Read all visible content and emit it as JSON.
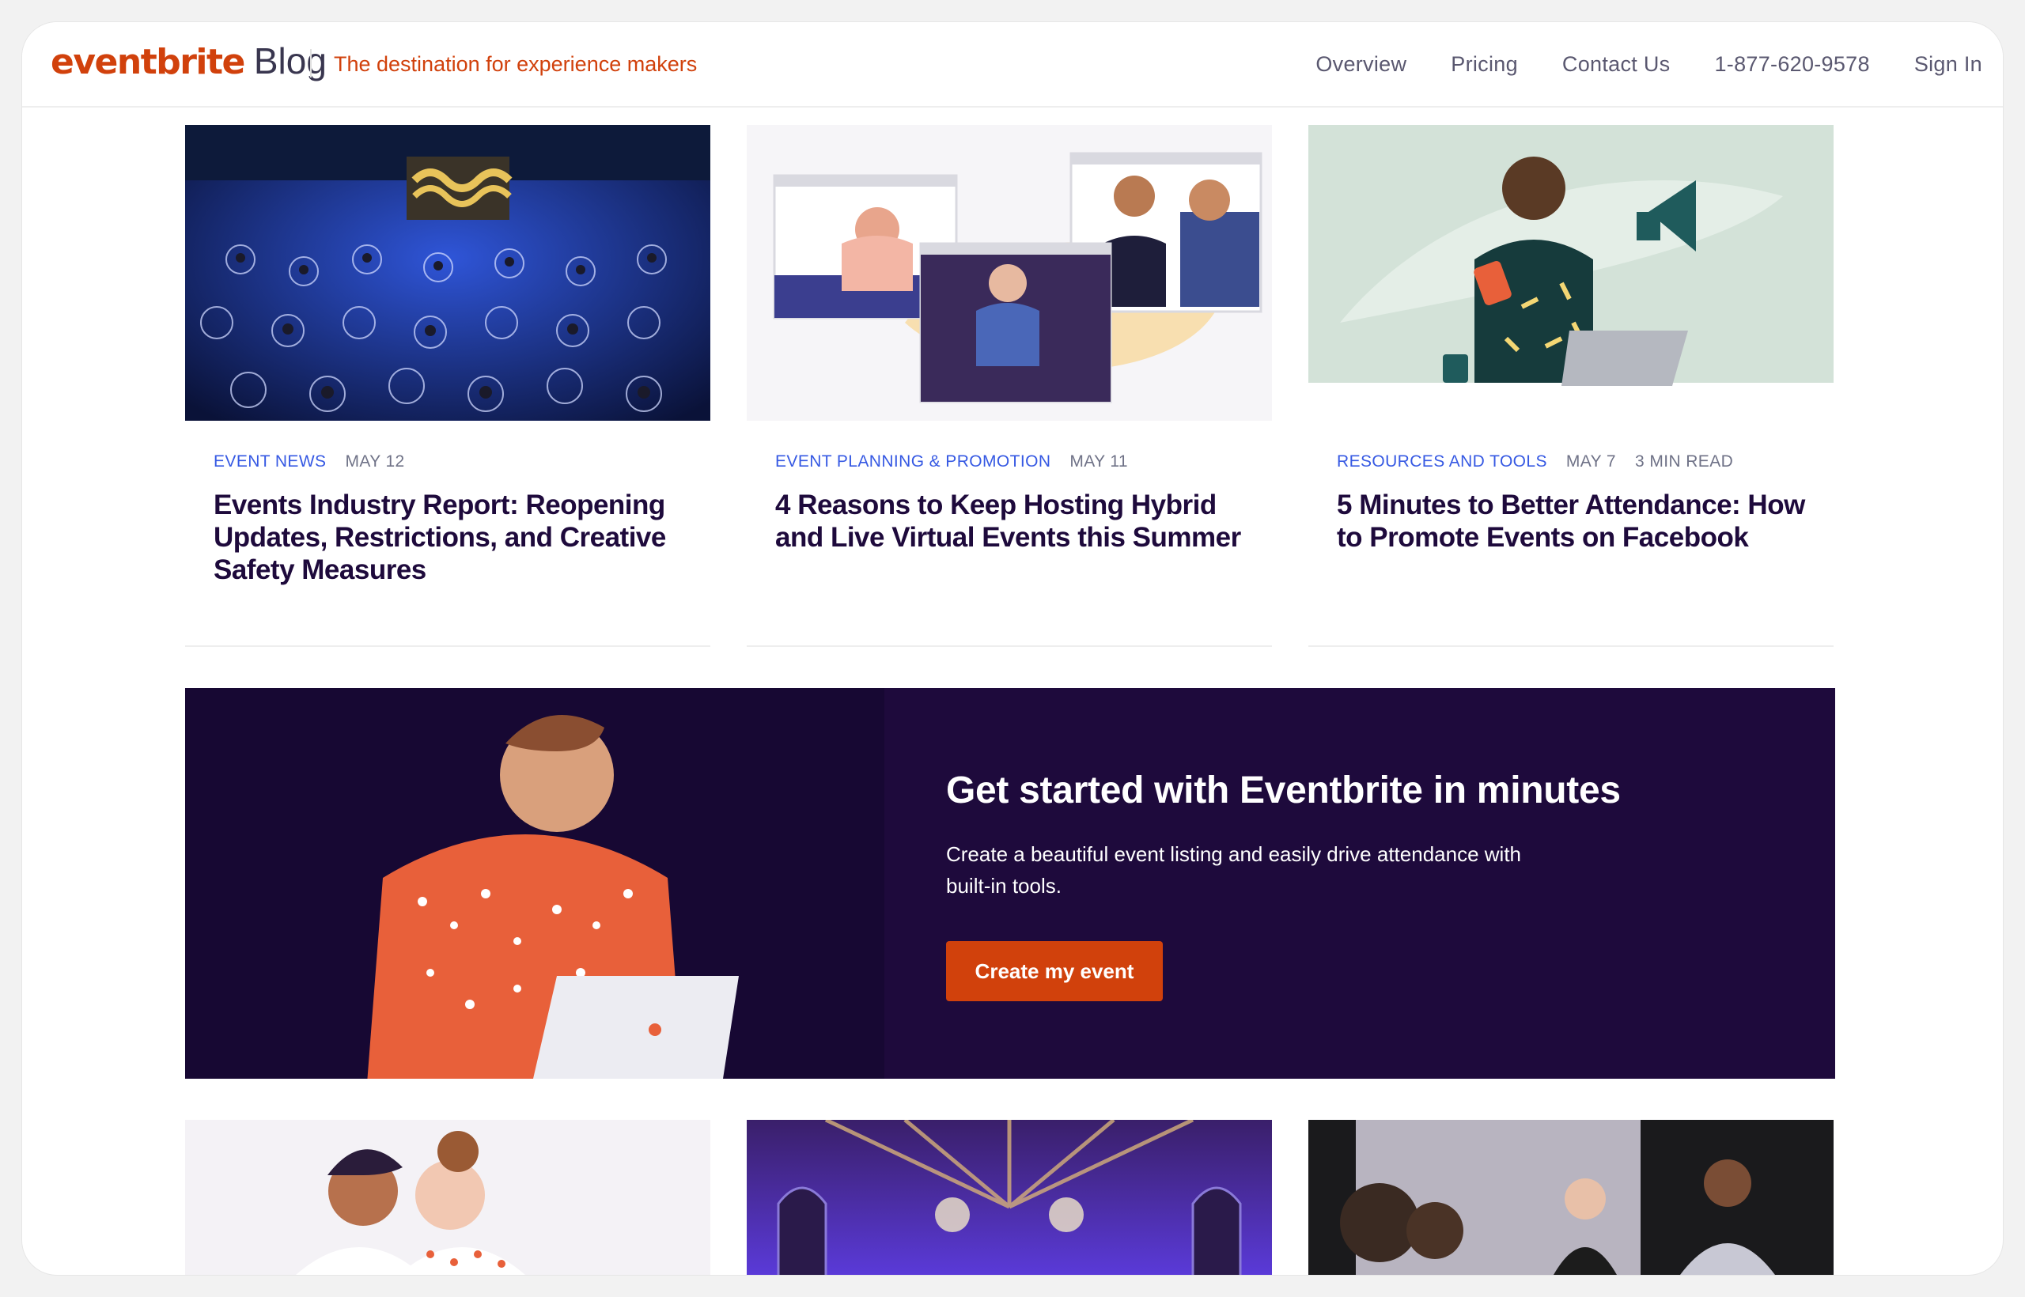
{
  "header": {
    "logo_word": "eventbrite",
    "logo_suffix": "Blog",
    "tagline": "The destination for experience makers",
    "nav": [
      "Overview",
      "Pricing",
      "Contact Us",
      "1-877-620-9578",
      "Sign In"
    ]
  },
  "cards": [
    {
      "category": "EVENT NEWS",
      "date": "MAY 12",
      "read_time": "",
      "title": "Events Industry Report: Reopening Updates, Restrictions, and Creative Safety Measures"
    },
    {
      "category": "EVENT PLANNING & PROMOTION",
      "date": "MAY 11",
      "read_time": "",
      "title": "4 Reasons to Keep Hosting Hybrid and Live Virtual Events this Summer"
    },
    {
      "category": "RESOURCES AND TOOLS",
      "date": "MAY 7",
      "read_time": "3 MIN READ",
      "title": "5 Minutes to Better Attendance: How to Promote Events on Facebook"
    }
  ],
  "promo": {
    "title": "Get started with Eventbrite in minutes",
    "description": "Create a beautiful event listing and easily drive attendance with built-in tools.",
    "button": "Create my event"
  },
  "colors": {
    "brand": "#d1410c",
    "navy": "#1e0a3c",
    "category_blue": "#3659e3"
  }
}
